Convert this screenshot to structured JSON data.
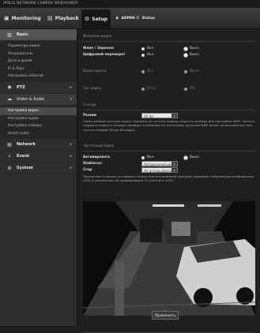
{
  "app": {
    "title": "IPOLIS NETWORK CAMERA WEBVIEWER"
  },
  "nav": {
    "monitoring": "Monitoring",
    "playback": "Playback",
    "setup": "Setup",
    "admin": "ADMIN",
    "status": "Status"
  },
  "sidebar": {
    "basic": "Basic",
    "basic_items": [
      "Параметры видео",
      "Пользователь",
      "Дата и время",
      "IP & Порт",
      "Настройка событий"
    ],
    "ptz": "PTZ",
    "video_audio": "Video & Audio",
    "va_items": [
      "Настройка видео",
      "Настройка аудио",
      "Настройка камеры",
      "Smart codec"
    ],
    "network": "Network",
    "event": "Event",
    "system": "System"
  },
  "content": {
    "source_title": "Источник видео",
    "flip_label": "Флип / Зеркало",
    "zoom_label": "Цифровой переворот",
    "on": "Вкл.",
    "off": "Выкл.",
    "video_out_label": "Видео выход",
    "video_type_label": "Тип видео",
    "ntsc": "NTSC",
    "pal": "PAL",
    "sensor_title": "Сенсор",
    "mode_label": "Режим",
    "mode_value": "30 fps",
    "sensor_note": "Смена режима датчика может повлиять на частоту кадров, скорость затвора или настройки WDR. Частота кадров и скорость затвора перейдут в значение по умолчанию, функция WDR может использоваться при частоте кадров 59 или 60 кадр/с.",
    "stab_title": "Частотный поиск",
    "active_label": "Активировать",
    "sens_label": "Stablerun",
    "sens_value": "Автоматическое",
    "crop_label": "Crop",
    "crop_value": "Не использовать",
    "stab_note": "Прозрачность можно установить только при отключенной функции цифровой стабилизации изображения (DIS) и увеличении, не превышающем 32-кратного (X32).",
    "preview_label": "← Показать",
    "apply": "Применить"
  }
}
